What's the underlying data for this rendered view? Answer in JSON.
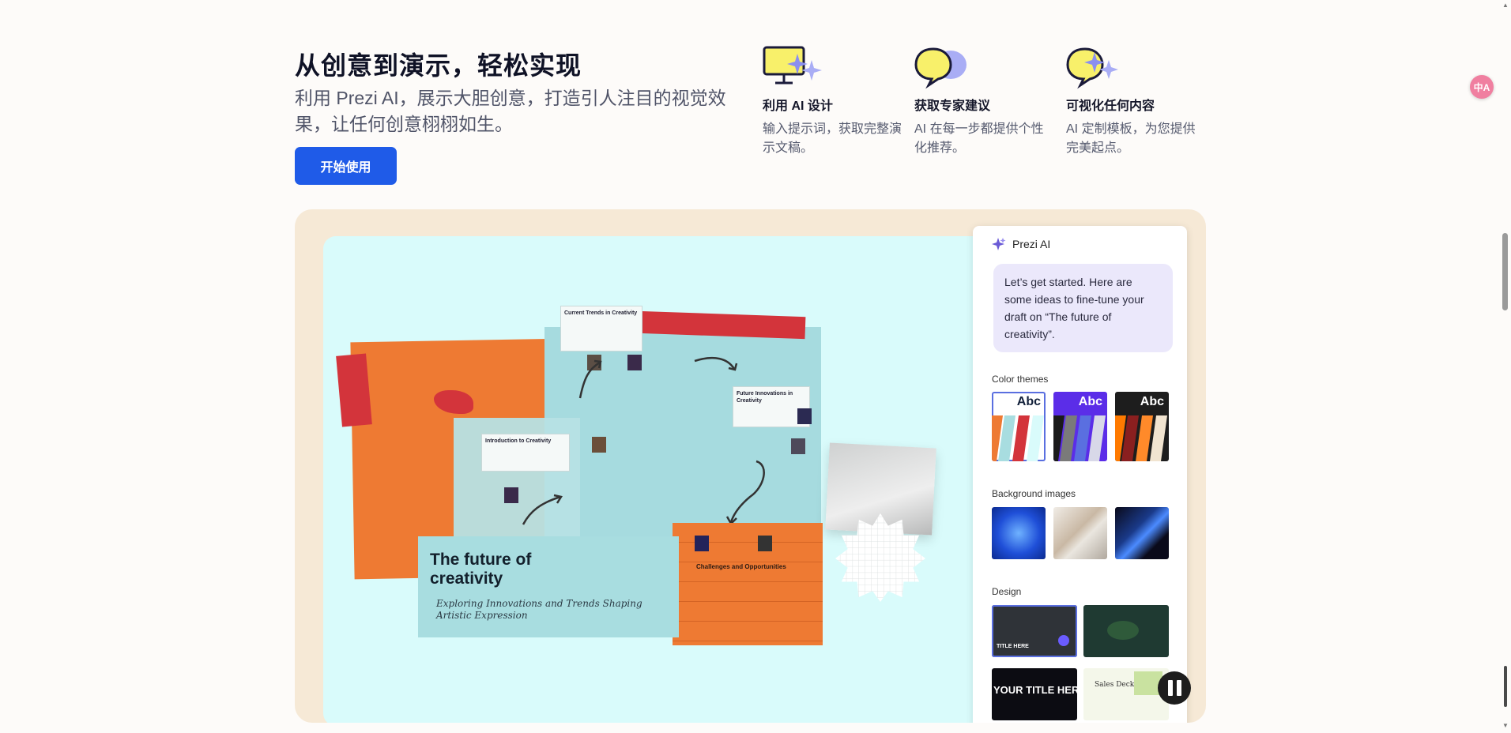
{
  "hero": {
    "title": "从创意到演示，轻松实现",
    "subtitle": "利用 Prezi AI，展示大胆创意，打造引人注目的视觉效果，让任何创意栩栩如生。",
    "cta_label": "开始使用"
  },
  "features": [
    {
      "title": "利用 AI 设计",
      "desc": "输入提示词，获取完整演示文稿。",
      "icon": "monitor-sparkle-icon"
    },
    {
      "title": "获取专家建议",
      "desc": "AI 在每一步都提供个性化推荐。",
      "icon": "chat-bubbles-icon"
    },
    {
      "title": "可视化任何内容",
      "desc": "AI 定制模板，为您提供完美起点。",
      "icon": "chat-sparkle-icon"
    }
  ],
  "translate_button": {
    "icon": "translate-icon",
    "label": "中A"
  },
  "canvas": {
    "title": "The future of creativity",
    "subtitle": "Exploring Innovations and Trends Shaping Artistic Expression",
    "cards": {
      "current_trends": "Current Trends in Creativity",
      "intro": "Introduction to Creativity",
      "future_innovations": "Future Innovations in Creativity",
      "challenges": "Challenges and Opportunities"
    }
  },
  "ai_panel": {
    "title": "Prezi AI",
    "message": "Let’s get started. Here are some ideas to fine-tune your draft on “The future of creativity”.",
    "color_themes_label": "Color themes",
    "theme_label": "Abc",
    "background_images_label": "Background images",
    "design_label": "Design",
    "design_thumbs": [
      "TITLE HERE",
      "",
      "YOUR TITLE HER",
      "Sales Deck"
    ]
  },
  "colors": {
    "accent": "#1f5be8",
    "canvas_bg": "#d9fbfb",
    "frame_bg": "#f6e9d6",
    "orange": "#ee7a33",
    "red": "#d3343b"
  }
}
